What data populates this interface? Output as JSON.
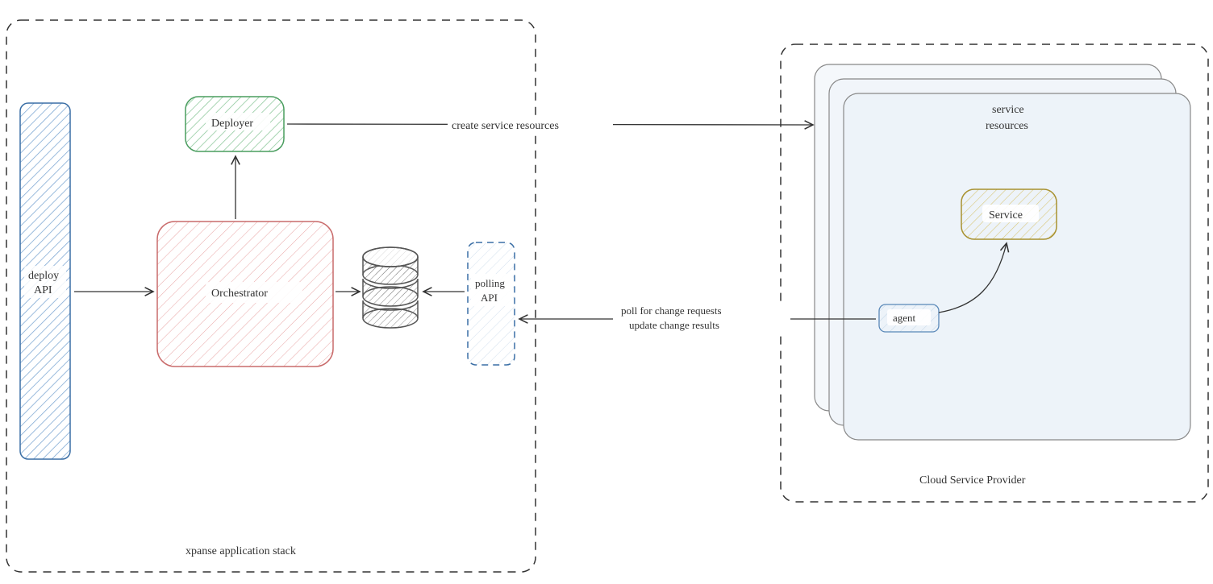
{
  "containers": {
    "xpanse": {
      "label": "xpanse application stack"
    },
    "csp": {
      "label": "Cloud Service Provider"
    },
    "service_resources": {
      "title_line1": "service",
      "title_line2": "resources"
    }
  },
  "nodes": {
    "deploy_api": {
      "label_line1": "deploy",
      "label_line2": "API"
    },
    "deployer": {
      "label": "Deployer"
    },
    "orchestrator": {
      "label": "Orchestrator"
    },
    "polling_api": {
      "label_line1": "polling",
      "label_line2": "API"
    },
    "service": {
      "label": "Service"
    },
    "agent": {
      "label": "agent"
    }
  },
  "edges": {
    "create": {
      "label": "create service resources"
    },
    "poll": {
      "line1": "poll for change requests",
      "line2": "update change results"
    }
  }
}
